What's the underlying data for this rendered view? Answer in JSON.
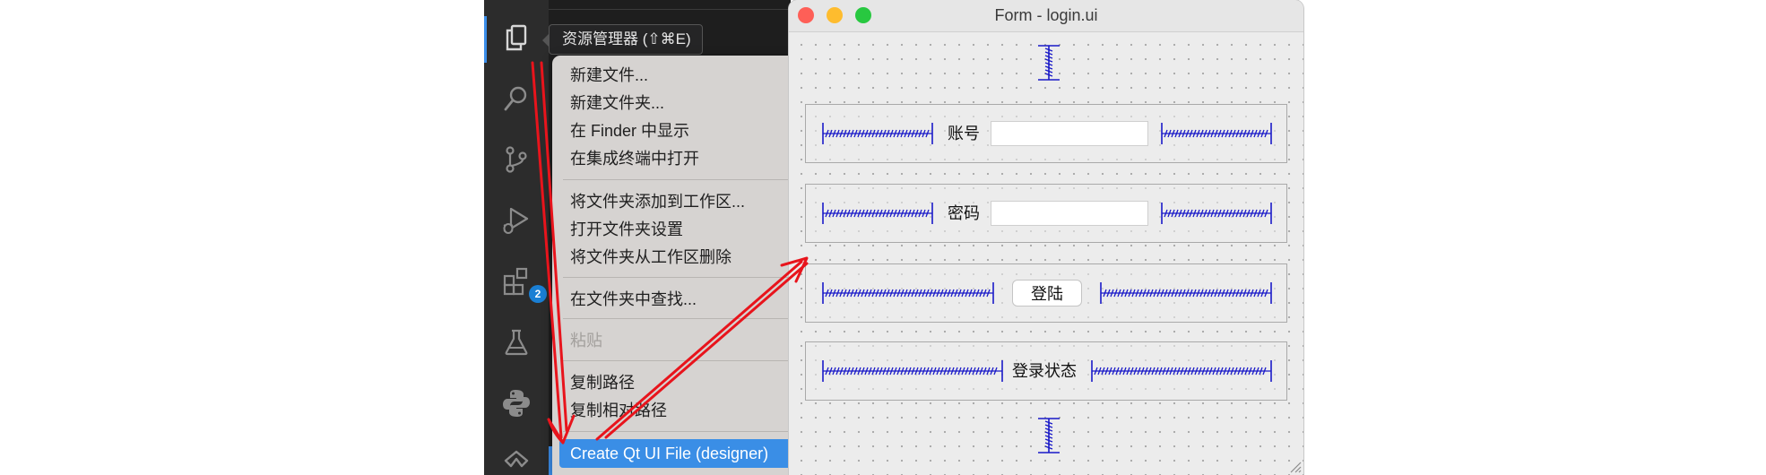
{
  "activity_bar": {
    "icons": [
      "explorer-icon",
      "search-icon",
      "source-control-icon",
      "run-debug-icon",
      "extensions-icon",
      "testing-icon",
      "python-icon",
      "qt-icon"
    ],
    "extensions_badge": "2",
    "accent": "#3b8eea"
  },
  "tooltip": {
    "text": "资源管理器 (⇧⌘E)"
  },
  "context_menu": {
    "items": [
      {
        "label": "新建文件..."
      },
      {
        "label": "新建文件夹..."
      },
      {
        "label": "在 Finder 中显示"
      },
      {
        "label": "在集成终端中打开"
      },
      {
        "label": "将文件夹添加到工作区..."
      },
      {
        "label": "打开文件夹设置"
      },
      {
        "label": "将文件夹从工作区删除"
      },
      {
        "label": "在文件夹中查找..."
      },
      {
        "label": "粘贴"
      },
      {
        "label": "复制路径"
      },
      {
        "label": "复制相对路径"
      },
      {
        "label": "Create Qt UI File (designer)"
      }
    ],
    "highlight_color": "#3a8ee6"
  },
  "qt_window": {
    "title": "Form - login.ui",
    "account_label": "账号",
    "account_value": "",
    "password_label": "密码",
    "password_value": "",
    "login_button": "登陆",
    "status_label": "登录状态"
  },
  "colors": {
    "spacer_blue": "#1a1ac8",
    "arrow_red": "#e8141c"
  }
}
